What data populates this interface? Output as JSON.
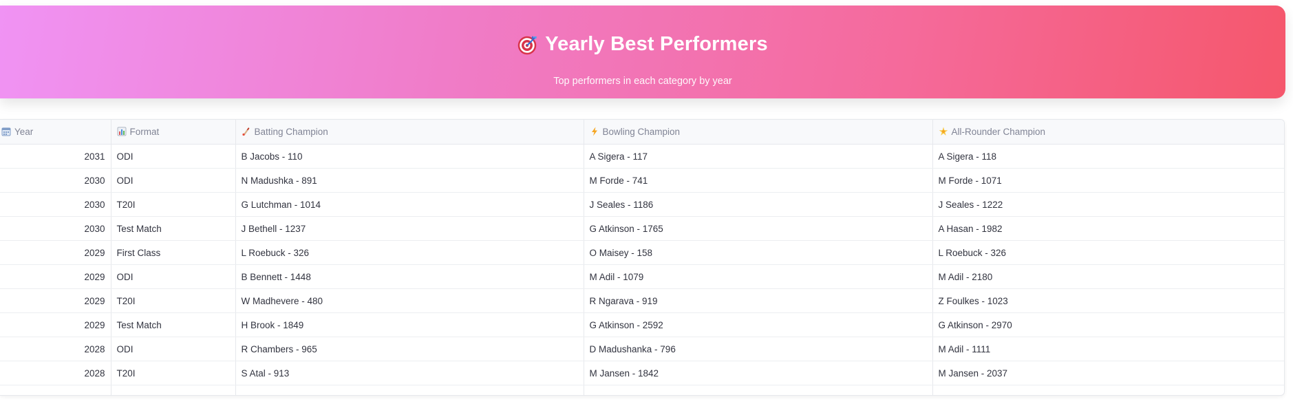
{
  "header": {
    "icon": "target-dart-icon",
    "title": "Yearly Best Performers",
    "subtitle": "Top performers in each category by year",
    "gradient_colors": [
      "#f093f4",
      "#f5576c"
    ]
  },
  "table": {
    "columns": [
      {
        "icon": "calendar-icon",
        "label": "Year"
      },
      {
        "icon": "bar-chart-icon",
        "label": "Format"
      },
      {
        "icon": "cricket-bat-icon",
        "label": "Batting Champion"
      },
      {
        "icon": "lightning-icon",
        "label": "Bowling Champion"
      },
      {
        "icon": "star-icon",
        "label": "All-Rounder Champion"
      }
    ],
    "rows": [
      {
        "year": "2031",
        "format": "ODI",
        "batting": "B Jacobs - 110",
        "bowling": "A Sigera - 117",
        "allrounder": "A Sigera - 118"
      },
      {
        "year": "2030",
        "format": "ODI",
        "batting": "N Madushka - 891",
        "bowling": "M Forde - 741",
        "allrounder": "M Forde - 1071"
      },
      {
        "year": "2030",
        "format": "T20I",
        "batting": "G Lutchman - 1014",
        "bowling": "J Seales - 1186",
        "allrounder": "J Seales - 1222"
      },
      {
        "year": "2030",
        "format": "Test Match",
        "batting": "J Bethell - 1237",
        "bowling": "G Atkinson - 1765",
        "allrounder": "A Hasan - 1982"
      },
      {
        "year": "2029",
        "format": "First Class",
        "batting": "L Roebuck - 326",
        "bowling": "O Maisey - 158",
        "allrounder": "L Roebuck - 326"
      },
      {
        "year": "2029",
        "format": "ODI",
        "batting": "B Bennett - 1448",
        "bowling": "M Adil - 1079",
        "allrounder": "M Adil - 2180"
      },
      {
        "year": "2029",
        "format": "T20I",
        "batting": "W Madhevere - 480",
        "bowling": "R Ngarava - 919",
        "allrounder": "Z Foulkes - 1023"
      },
      {
        "year": "2029",
        "format": "Test Match",
        "batting": "H Brook - 1849",
        "bowling": "G Atkinson - 2592",
        "allrounder": "G Atkinson - 2970"
      },
      {
        "year": "2028",
        "format": "ODI",
        "batting": "R Chambers - 965",
        "bowling": "D Madushanka - 796",
        "allrounder": "M Adil - 1111"
      },
      {
        "year": "2028",
        "format": "T20I",
        "batting": "S Atal - 913",
        "bowling": "M Jansen - 1842",
        "allrounder": "M Jansen - 2037"
      },
      {
        "year": "",
        "format": "",
        "batting": "",
        "bowling": "",
        "allrounder": ""
      }
    ]
  }
}
